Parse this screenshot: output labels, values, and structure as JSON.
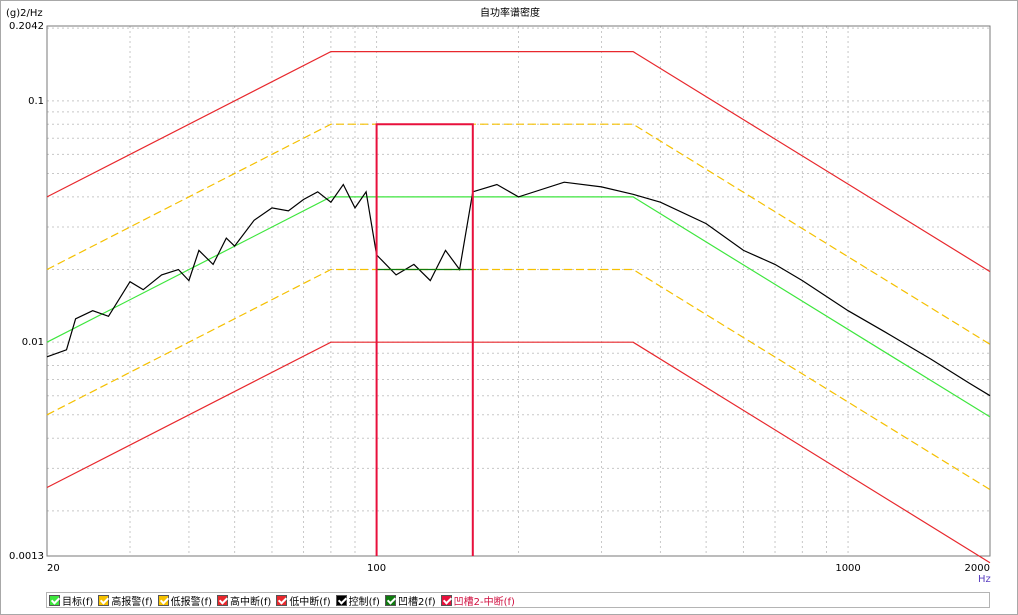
{
  "chart_data": {
    "type": "line",
    "title": "自功率谱密度",
    "ylabel": "(g)2/Hz",
    "xlabel": "Hz",
    "x_scale": "log",
    "y_scale": "log",
    "xlim": [
      20,
      2000
    ],
    "ylim": [
      0.0013,
      0.2042
    ],
    "x_ticks": [
      20,
      100,
      1000,
      2000
    ],
    "y_ticks": [
      0.0013,
      0.01,
      0.1,
      0.2042
    ],
    "x_tick_labels": [
      "20",
      "100",
      "1000",
      "2000"
    ],
    "y_tick_labels": [
      "0.0013",
      "0.01",
      "0.1",
      "0.2042"
    ],
    "grid": true,
    "legend_position": "bottom",
    "series": [
      {
        "name": "目标(f)",
        "color": "#3ee63e",
        "style": "solid",
        "x": [
          20,
          80,
          100,
          160,
          350,
          2000
        ],
        "y": [
          0.01,
          0.04,
          0.04,
          0.04,
          0.04,
          0.0049
        ]
      },
      {
        "name": "高报警(f)",
        "color": "#f5c000",
        "style": "dashed",
        "x": [
          20,
          80,
          350,
          2000
        ],
        "y": [
          0.02,
          0.08,
          0.08,
          0.0098
        ]
      },
      {
        "name": "低报警(f)",
        "color": "#f5c000",
        "style": "dashed",
        "x": [
          20,
          80,
          350,
          2000
        ],
        "y": [
          0.005,
          0.02,
          0.02,
          0.00245
        ]
      },
      {
        "name": "高中断(f)",
        "color": "#e8282d",
        "style": "solid",
        "x": [
          20,
          80,
          350,
          2000
        ],
        "y": [
          0.04,
          0.16,
          0.16,
          0.0196
        ]
      },
      {
        "name": "低中断(f)",
        "color": "#e8282d",
        "style": "solid",
        "x": [
          20,
          80,
          350,
          2000
        ],
        "y": [
          0.0025,
          0.01,
          0.01,
          0.00122
        ]
      },
      {
        "name": "控制(f)",
        "color": "#000000",
        "style": "solid",
        "x": [
          20,
          22,
          23,
          25,
          27,
          30,
          32,
          35,
          38,
          40,
          42,
          45,
          48,
          50,
          55,
          60,
          65,
          70,
          75,
          80,
          85,
          90,
          95,
          100,
          110,
          120,
          130,
          140,
          150,
          160,
          180,
          200,
          250,
          300,
          350,
          400,
          500,
          600,
          700,
          800,
          1000,
          1200,
          1500,
          1800,
          2000
        ],
        "y": [
          0.0087,
          0.0093,
          0.0125,
          0.0135,
          0.0128,
          0.0178,
          0.0165,
          0.019,
          0.02,
          0.018,
          0.024,
          0.021,
          0.027,
          0.025,
          0.032,
          0.036,
          0.035,
          0.039,
          0.042,
          0.038,
          0.045,
          0.036,
          0.042,
          0.023,
          0.019,
          0.021,
          0.018,
          0.024,
          0.02,
          0.042,
          0.045,
          0.04,
          0.046,
          0.044,
          0.041,
          0.038,
          0.031,
          0.024,
          0.021,
          0.018,
          0.0135,
          0.011,
          0.0085,
          0.0068,
          0.006
        ]
      },
      {
        "name": "凹槽2(f)",
        "color": "#0e7a0e",
        "style": "solid",
        "x": [
          100,
          160
        ],
        "y": [
          0.02,
          0.02
        ]
      },
      {
        "name": "凹槽2-中断(f)",
        "color": "#e8103c",
        "style": "solid",
        "x": [
          100,
          100,
          160,
          160
        ],
        "y": [
          0.0013,
          0.08,
          0.08,
          0.0013
        ]
      }
    ]
  }
}
